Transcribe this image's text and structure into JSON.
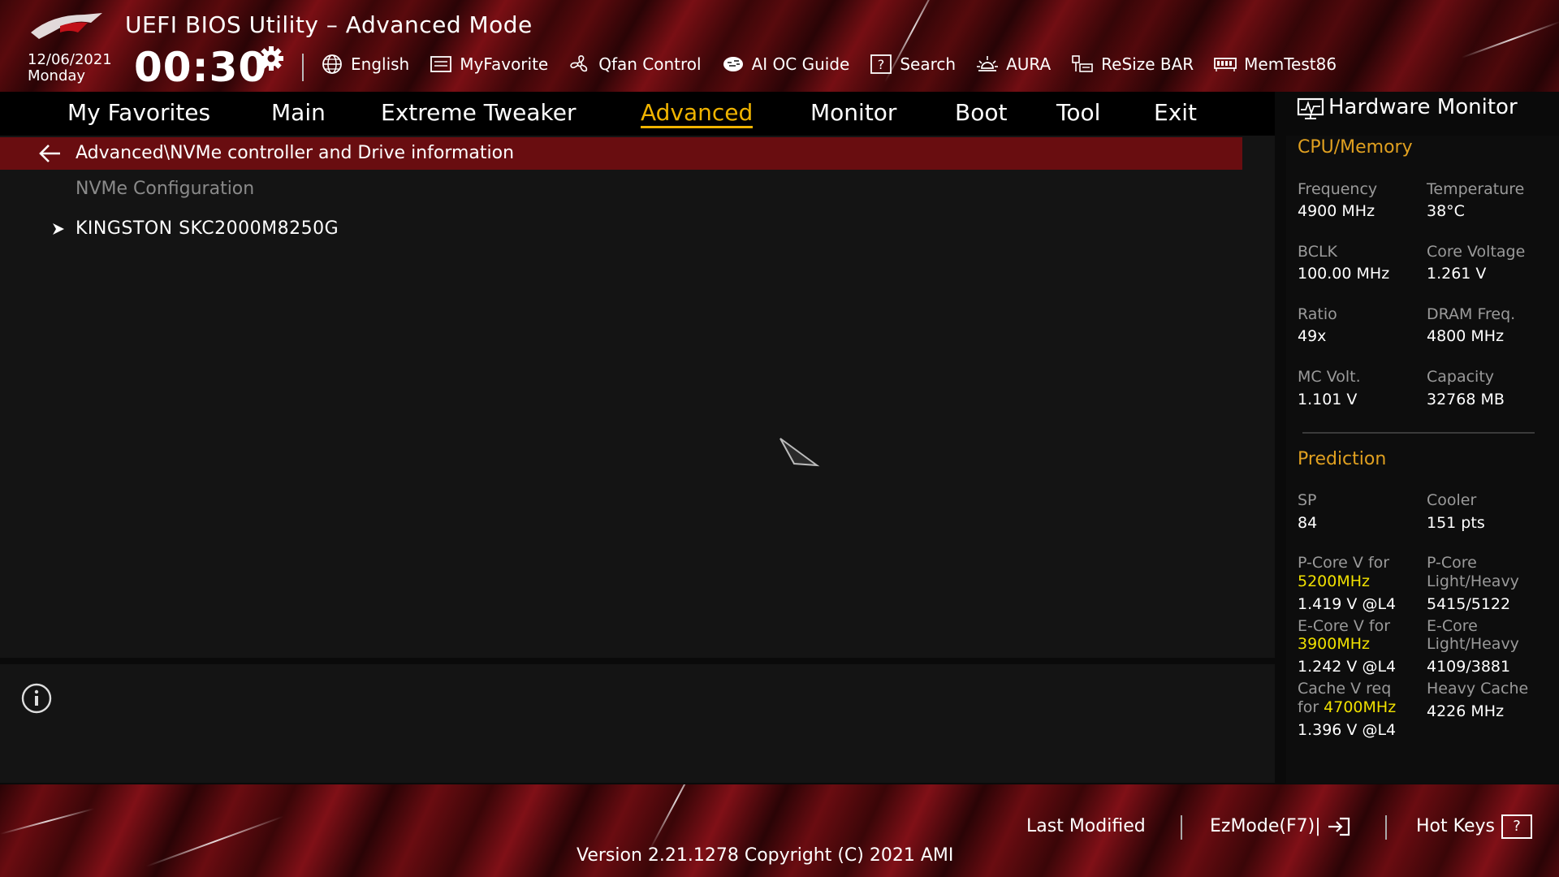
{
  "header": {
    "title": "UEFI BIOS Utility – Advanced Mode",
    "date": "12/06/2021",
    "weekday": "Monday",
    "time": "00:30"
  },
  "toolbar": {
    "items": [
      {
        "label": "English",
        "icon": "globe-icon"
      },
      {
        "label": "MyFavorite",
        "icon": "favorite-icon"
      },
      {
        "label": "Qfan Control",
        "icon": "fan-icon"
      },
      {
        "label": "AI OC Guide",
        "icon": "ai-icon"
      },
      {
        "label": "Search",
        "icon": "search-icon"
      },
      {
        "label": "AURA",
        "icon": "aura-icon"
      },
      {
        "label": "ReSize BAR",
        "icon": "resizebar-icon"
      },
      {
        "label": "MemTest86",
        "icon": "memory-icon"
      }
    ]
  },
  "tabs": [
    {
      "label": "My Favorites"
    },
    {
      "label": "Main"
    },
    {
      "label": "Extreme Tweaker"
    },
    {
      "label": "Advanced",
      "active": true
    },
    {
      "label": "Monitor"
    },
    {
      "label": "Boot"
    },
    {
      "label": "Tool"
    },
    {
      "label": "Exit"
    }
  ],
  "main": {
    "path": "Advanced\\NVMe controller and Drive information",
    "section_label": "NVMe Configuration",
    "drive": "KINGSTON SKC2000M8250G"
  },
  "hw_monitor": {
    "title": "Hardware Monitor",
    "cpu_memory": {
      "heading": "CPU/Memory",
      "frequency_label": "Frequency",
      "frequency_value": "4900 MHz",
      "temperature_label": "Temperature",
      "temperature_value": "38°C",
      "bclk_label": "BCLK",
      "bclk_value": "100.00 MHz",
      "core_voltage_label": "Core Voltage",
      "core_voltage_value": "1.261 V",
      "ratio_label": "Ratio",
      "ratio_value": "49x",
      "dram_label": "DRAM Freq.",
      "dram_value": "4800 MHz",
      "mc_label": "MC Volt.",
      "mc_value": "1.101 V",
      "capacity_label": "Capacity",
      "capacity_value": "32768 MB"
    },
    "prediction": {
      "heading": "Prediction",
      "sp_label": "SP",
      "sp_value": "84",
      "cooler_label": "Cooler",
      "cooler_value": "151 pts",
      "pcore_v_label": "P-Core V for",
      "pcore_v_freq": "5200MHz",
      "pcore_v_value": "1.419 V @L4",
      "pcore_lh_label_1": "P-Core",
      "pcore_lh_label_2": "Light/Heavy",
      "pcore_lh_value": "5415/5122",
      "ecore_v_label": "E-Core V for",
      "ecore_v_freq": "3900MHz",
      "ecore_v_value": "1.242 V @L4",
      "ecore_lh_label_1": "E-Core",
      "ecore_lh_label_2": "Light/Heavy",
      "ecore_lh_value": "4109/3881",
      "cache_v_label_1": "Cache V req",
      "cache_v_label_2": "for",
      "cache_v_freq": "4700MHz",
      "cache_v_value": "1.396 V @L4",
      "heavy_cache_label": "Heavy Cache",
      "heavy_cache_value": "4226 MHz"
    }
  },
  "footer": {
    "last_modified": "Last Modified",
    "ezmode": "EzMode(F7)|",
    "hotkeys": "Hot Keys",
    "hotkeys_key": "?",
    "version": "Version 2.21.1278 Copyright (C) 2021 AMI"
  },
  "colors": {
    "accent": "#f0b400",
    "section_heading": "#e0a020",
    "path_bar": "#690d10",
    "frequency_highlight": "#f0e000"
  }
}
